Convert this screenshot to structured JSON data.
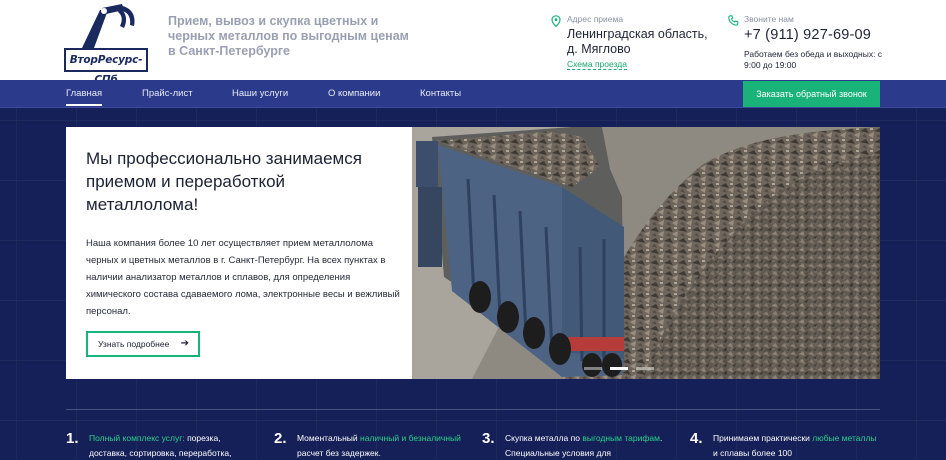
{
  "brand": {
    "logo_text": "ВторРесурс-СПб",
    "tagline": "Прием, вывоз и скупка цветных и черных металлов по выгодным ценам в Санкт-Петербурге"
  },
  "address": {
    "label": "Адрес приема",
    "value": "Ленинградская область, д. Мяглово",
    "link": "Схема проезда"
  },
  "contact": {
    "label": "Звоните нам",
    "phone": "+7 (911) 927-69-09",
    "hours": "Работаем без обеда и выходных: с 9:00 до 19:00"
  },
  "nav": {
    "items": [
      {
        "label": "Главная",
        "active": true
      },
      {
        "label": "Прайс-лист"
      },
      {
        "label": "Наши услуги"
      },
      {
        "label": "О компании"
      },
      {
        "label": "Контакты"
      }
    ],
    "callback_button": "Заказать обратный звонок"
  },
  "hero": {
    "title": "Мы профессионально занимаемся приемом и переработкой металлолома!",
    "text": "Наша компания более 10 лет осуществляет прием металлолома  черных и цветных металлов в г. Санкт-Петербург. На всех пунктах в наличии анализатор металлов и сплавов, для определения химического состава сдаваемого лома, электронные весы и вежливый персонал.",
    "button": "Узнать подробнее",
    "slides_total": 3,
    "slide_active": 2
  },
  "features": [
    {
      "num": "1.",
      "highlight": "Полный комплекс услуг:",
      "text_after": " порезка, доставка, сортировка, переработка,"
    },
    {
      "num": "2.",
      "text_before": "Моментальный ",
      "highlight": "наличный и безналичный",
      "text_after": " расчет без задержек."
    },
    {
      "num": "3.",
      "text_before": "Скупка металла по ",
      "highlight": "выгодным тарифам",
      "text_after": ". Специальные условия для"
    },
    {
      "num": "4.",
      "text_before": "Принимаем практически ",
      "highlight": "любые металлы",
      "text_after": " и сплавы более 100"
    }
  ],
  "colors": {
    "accent_green": "#19b37a",
    "nav_blue": "#2b3a8b",
    "page_navy": "#142057"
  }
}
